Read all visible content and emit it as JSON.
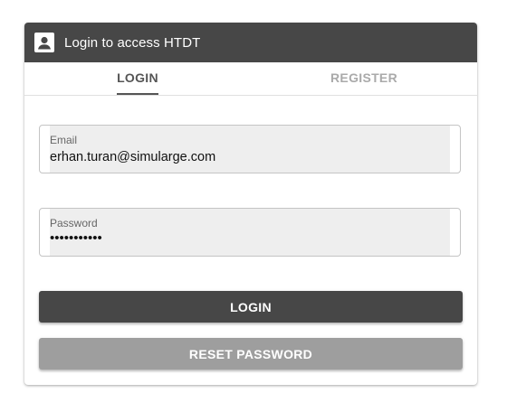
{
  "header": {
    "title": "Login to access HTDT",
    "icon": "account-box-icon"
  },
  "tabs": [
    {
      "label": "LOGIN",
      "active": true
    },
    {
      "label": "REGISTER",
      "active": false
    }
  ],
  "form": {
    "email": {
      "label": "Email",
      "value": "erhan.turan@simularge.com"
    },
    "password": {
      "label": "Password",
      "value": "•••••••••••"
    }
  },
  "buttons": {
    "login_label": "LOGIN",
    "reset_label": "RESET PASSWORD"
  },
  "colors": {
    "header_bg": "#474747",
    "primary_button": "#474747",
    "secondary_button": "#9e9e9e",
    "field_fill": "#eeeeee"
  }
}
